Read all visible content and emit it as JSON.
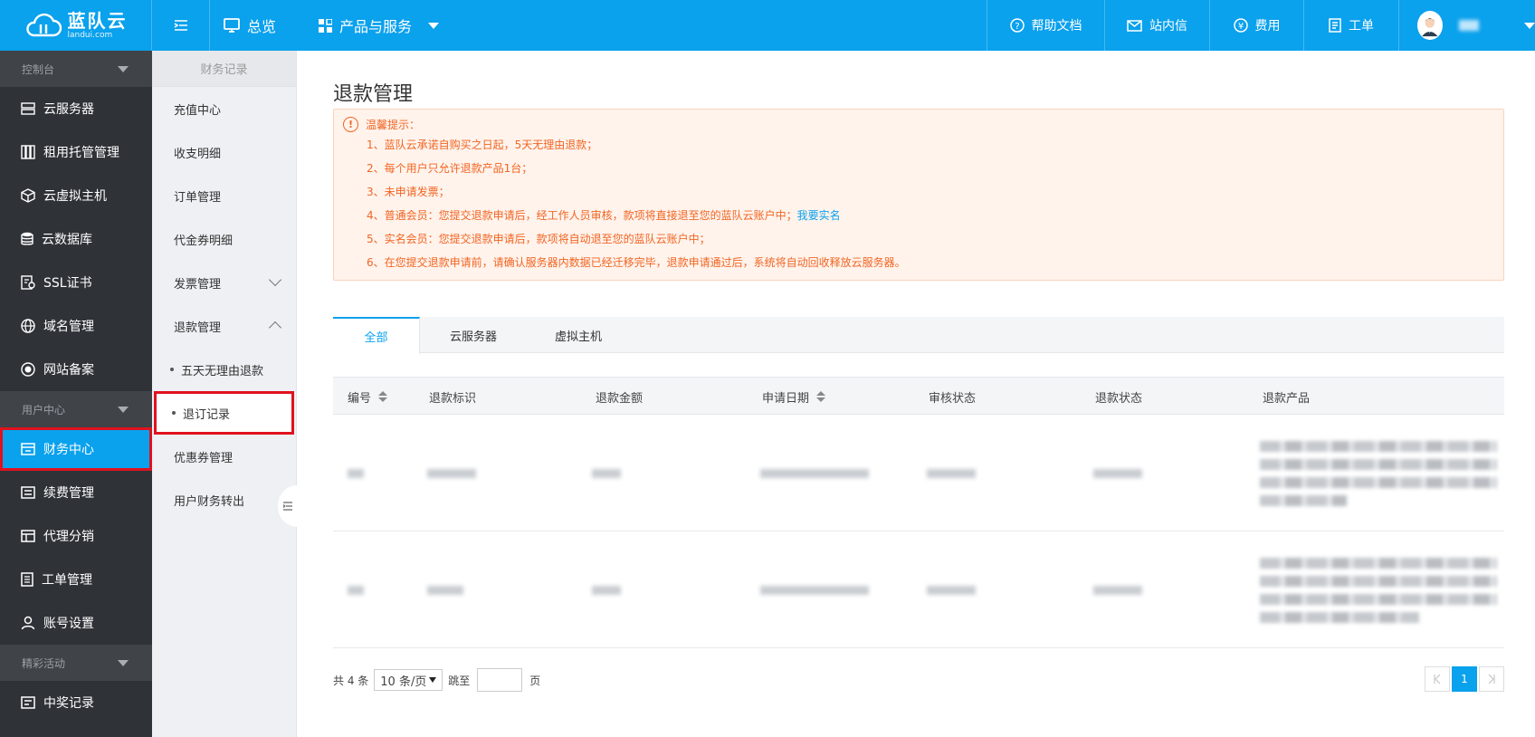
{
  "header": {
    "logo_main": "蓝队云",
    "logo_sub": "landui.com",
    "nav_overview": "总览",
    "nav_products": "产品与服务",
    "help": "帮助文档",
    "mail": "站内信",
    "fee": "费用",
    "ticket": "工单"
  },
  "sidebar": {
    "group_console": "控制台",
    "items_console": [
      "云服务器",
      "租用托管管理",
      "云虚拟主机",
      "云数据库",
      "SSL证书",
      "域名管理",
      "网站备案"
    ],
    "group_user": "用户中心",
    "items_user": [
      "财务中心",
      "续费管理",
      "代理分销",
      "工单管理",
      "账号设置"
    ],
    "group_activity": "精彩活动",
    "items_activity": [
      "中奖记录"
    ]
  },
  "subnav": {
    "title": "财务记录",
    "items": [
      "充值中心",
      "收支明细",
      "订单管理",
      "代金券明细",
      "发票管理",
      "退款管理"
    ],
    "children": [
      "五天无理由退款",
      "退订记录"
    ],
    "items_after": [
      "优惠券管理",
      "用户财务转出"
    ]
  },
  "main": {
    "title": "退款管理",
    "notice": {
      "head": "温馨提示：",
      "lines": [
        "1、蓝队云承诺自购买之日起，5天无理由退款；",
        "2、每个用户只允许退款产品1台；",
        "3、未申请发票；",
        "4、普通会员：您提交退款申请后，经工作人员审核，款项将直接退至您的蓝队云账户中；",
        "5、实名会员：您提交退款申请后，款项将自动退至您的蓝队云账户中；",
        "6、在您提交退款申请前，请确认服务器内数据已经迁移完毕，退款申请通过后，系统将自动回收释放云服务器。"
      ],
      "link": "我要实名"
    },
    "tabs": [
      "全部",
      "云服务器",
      "虚拟主机"
    ],
    "columns": [
      "编号",
      "退款标识",
      "退款金额",
      "申请日期",
      "审核状态",
      "退款状态",
      "退款产品"
    ],
    "pager": {
      "total": "共 4 条",
      "size": "10 条/页",
      "jump": "跳至",
      "page_suffix": "页",
      "current": "1"
    }
  },
  "colors": {
    "brand": "#0aa1ed",
    "warning": "#f26522",
    "highlight": "#e0121f"
  }
}
